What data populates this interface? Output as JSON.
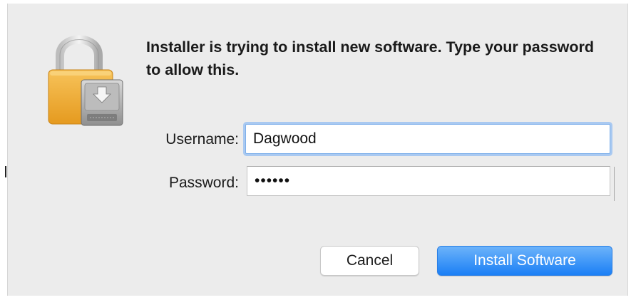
{
  "dialog": {
    "message": "Installer is trying to install new software. Type your password to allow this.",
    "icon": "lock-with-installer-icon"
  },
  "form": {
    "username_label": "Username:",
    "username_value": "Dagwood",
    "password_label": "Password:",
    "password_masked": "••••••"
  },
  "buttons": {
    "cancel_label": "Cancel",
    "install_label": "Install Software"
  },
  "colors": {
    "dialog_background": "#ececec",
    "accent_blue": "#1b7ff5",
    "focus_ring": "#a9c9f1",
    "lock_gold": "#f2b43a"
  }
}
